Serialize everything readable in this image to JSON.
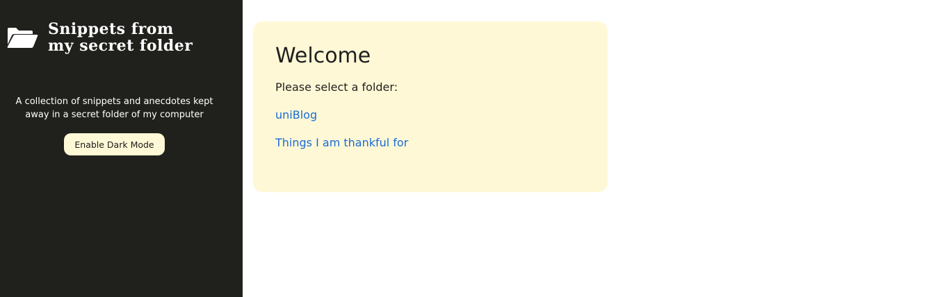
{
  "sidebar": {
    "title": "Snippets from\nmy secret folder",
    "tagline": "A collection of snippets and anecdotes kept away in a secret folder of my computer",
    "dark_mode_button": "Enable Dark Mode",
    "icon": "folder-open-icon"
  },
  "main": {
    "heading": "Welcome",
    "prompt": "Please select a folder:",
    "folders": [
      {
        "label": "uniBlog"
      },
      {
        "label": "Things I am thankful for"
      }
    ]
  },
  "colors": {
    "sidebar_bg": "#20201c",
    "card_bg": "#fff8d6",
    "button_bg": "#fff8d6",
    "link": "#1a6bd6",
    "text": "#1f1f1f"
  }
}
